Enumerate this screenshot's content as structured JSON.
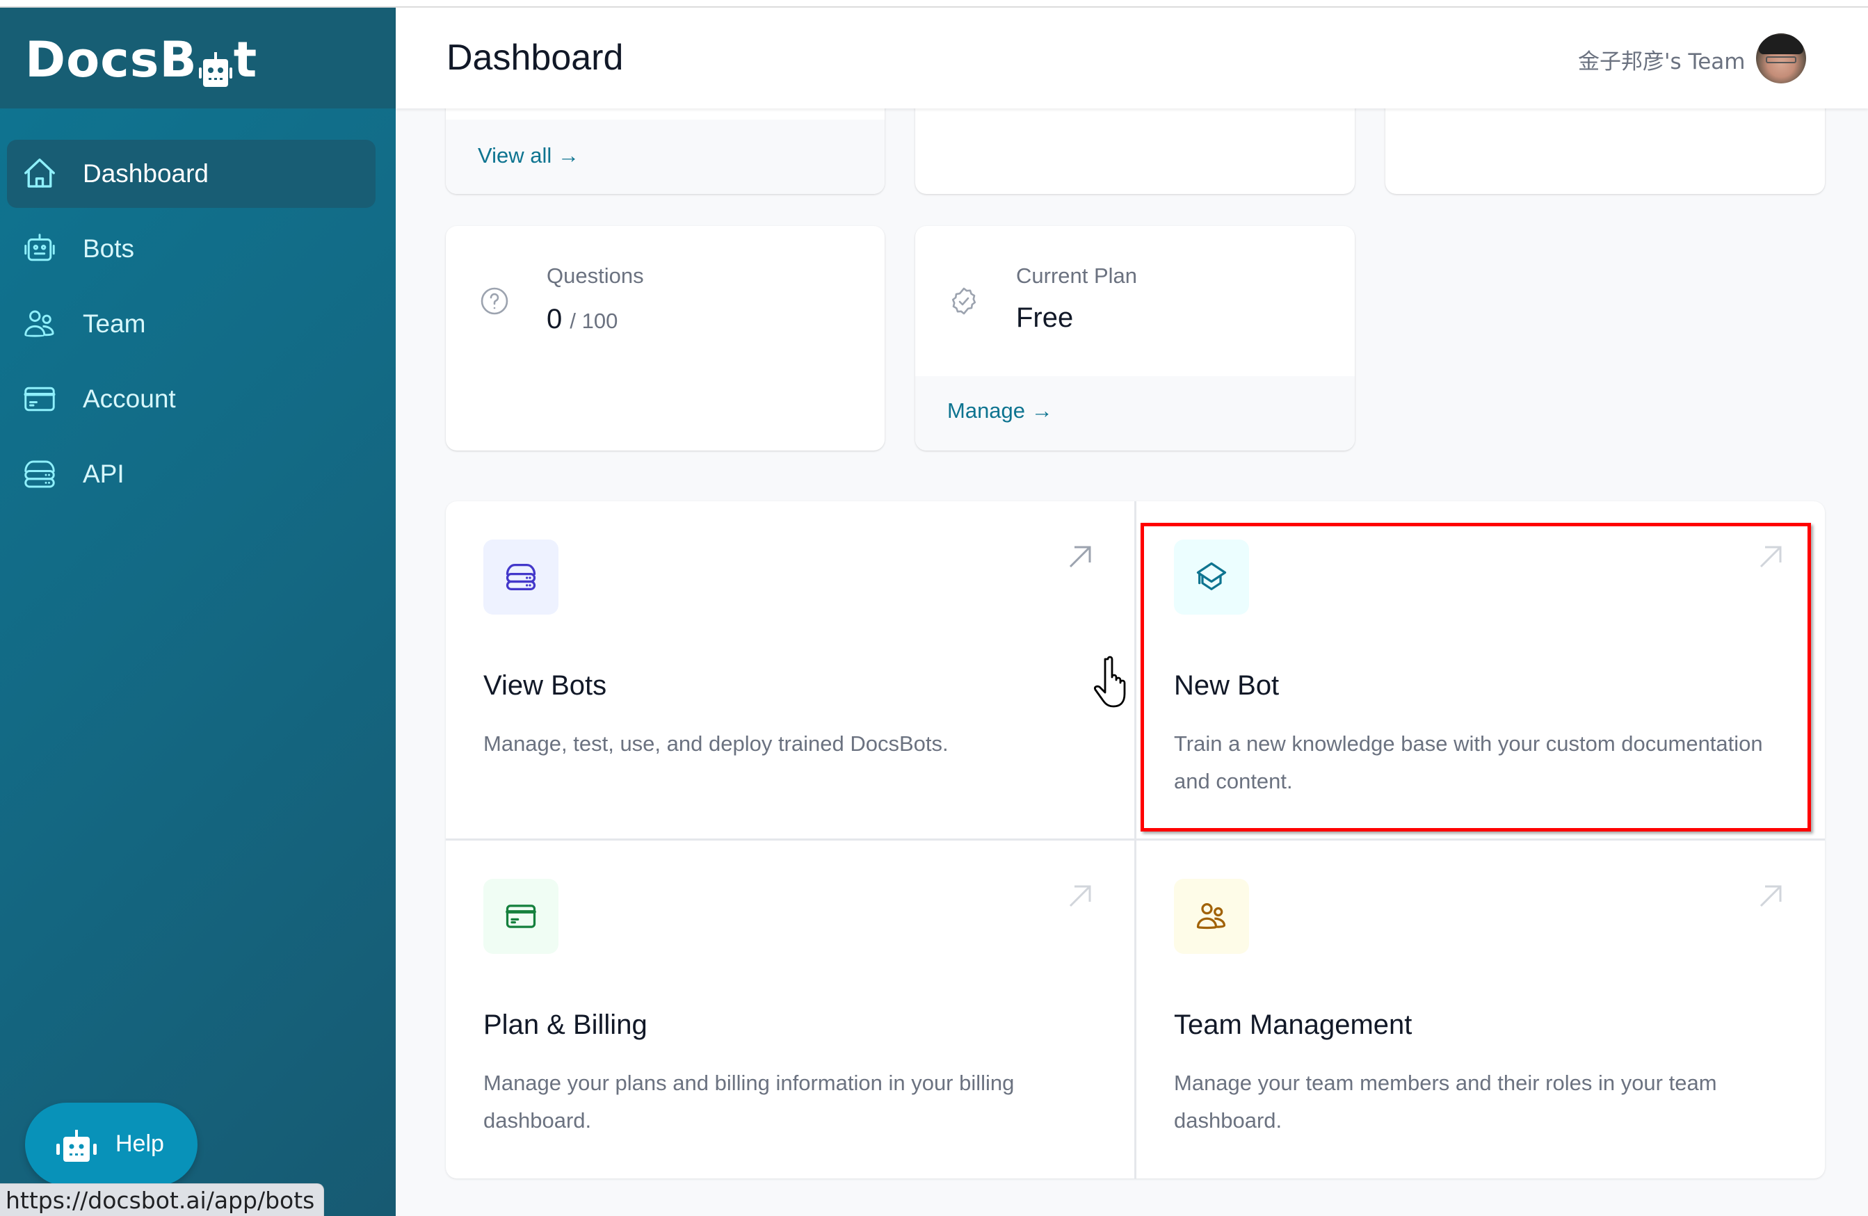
{
  "browser": {
    "status_url": "https://docsbot.ai/app/bots"
  },
  "sidebar": {
    "logo": {
      "text_before": "DocsB",
      "text_after": "t"
    },
    "items": [
      {
        "label": "Dashboard",
        "icon": "home-icon",
        "active": true
      },
      {
        "label": "Bots",
        "icon": "robot-icon",
        "active": false
      },
      {
        "label": "Team",
        "icon": "users-icon",
        "active": false
      },
      {
        "label": "Account",
        "icon": "credit-card-icon",
        "active": false
      },
      {
        "label": "API",
        "icon": "server-icon",
        "active": false
      }
    ],
    "help_label": "Help"
  },
  "header": {
    "title": "Dashboard",
    "team_name": "金子邦彦's Team"
  },
  "stats": {
    "top_row": {
      "card1_link": "View all →"
    },
    "questions": {
      "label": "Questions",
      "value": "0",
      "limit": "/ 100",
      "icon": "question-circle-icon"
    },
    "plan": {
      "label": "Current Plan",
      "value": "Free",
      "link": "Manage →",
      "icon": "badge-check-icon"
    }
  },
  "actions": [
    {
      "title": "View Bots",
      "description": "Manage, test, use, and deploy trained DocsBots.",
      "icon": "server-stack-icon",
      "color": "#4338ca",
      "bg": "#eef2ff"
    },
    {
      "title": "New Bot",
      "description": "Train a new knowledge base with your custom documentation and content.",
      "icon": "graduation-cap-icon",
      "color": "#0e7490",
      "bg": "#ecfeff"
    },
    {
      "title": "Plan & Billing",
      "description": "Manage your plans and billing information in your billing dashboard.",
      "icon": "credit-card-icon",
      "color": "#15803d",
      "bg": "#f0fdf4"
    },
    {
      "title": "Team Management",
      "description": "Manage your team members and their roles in your team dashboard.",
      "icon": "users-icon",
      "color": "#a16207",
      "bg": "#fefce8"
    }
  ],
  "colors": {
    "accent": "#0e7490",
    "sidebar": "#136a85",
    "annotation": "#ff0000"
  }
}
